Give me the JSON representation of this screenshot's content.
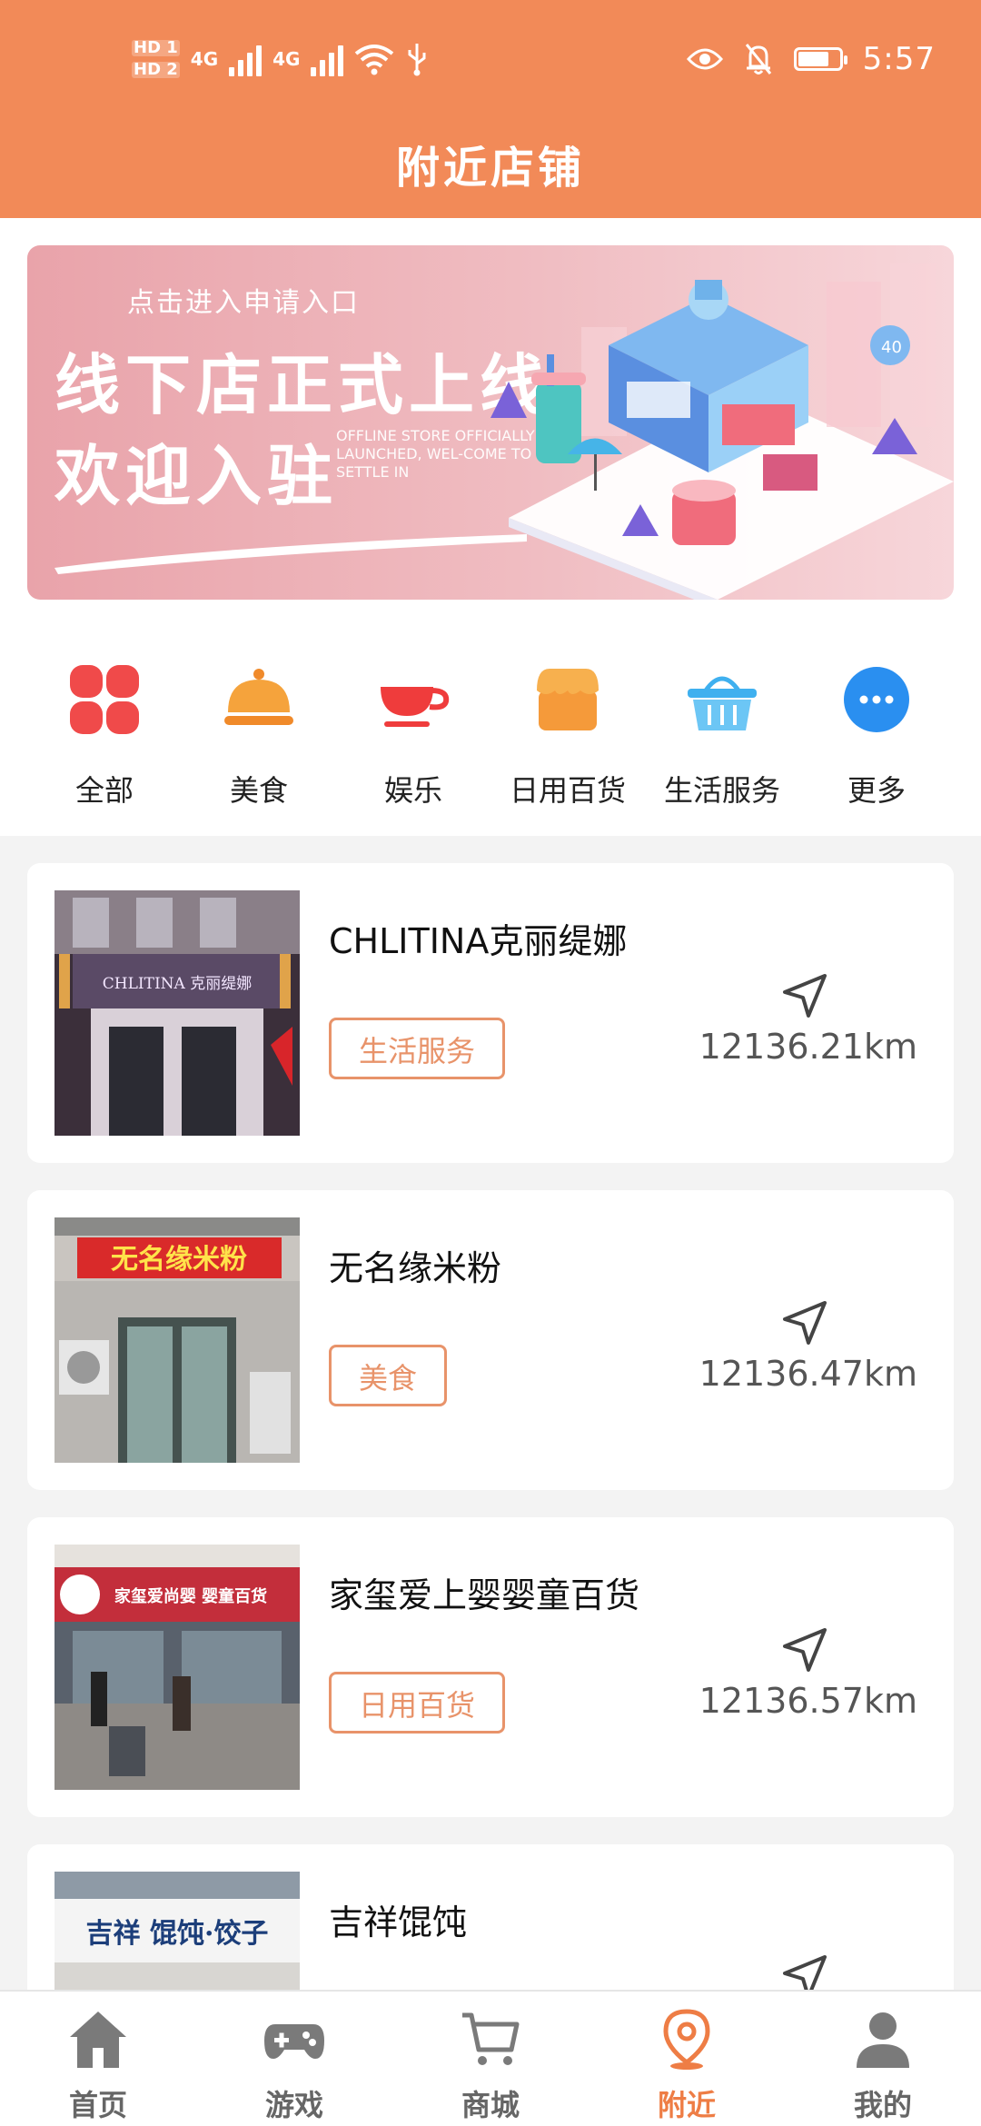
{
  "status_bar": {
    "hd1": "HD 1",
    "hd2": "HD 2",
    "net1": "4G",
    "net2": "4G",
    "time": "5:57"
  },
  "header": {
    "title": "附近店铺"
  },
  "banner": {
    "apply_text": "点击进入申请入口",
    "line1": "线下店正式上线",
    "line2": "欢迎入驻",
    "english": "OFFLINE STORE OFFICIALLY LAUNCHED, WEL-COME TO SETTLE IN"
  },
  "categories": [
    {
      "label": "全部",
      "icon": "clover-icon",
      "color": "#f04a4a"
    },
    {
      "label": "美食",
      "icon": "food-cloche-icon",
      "color": "#f08a2a"
    },
    {
      "label": "娱乐",
      "icon": "cup-icon",
      "color": "#ef3c3c"
    },
    {
      "label": "日用百货",
      "icon": "shop-icon",
      "color": "#f59a3a"
    },
    {
      "label": "生活服务",
      "icon": "basket-icon",
      "color": "#3fb0ef"
    },
    {
      "label": "更多",
      "icon": "more-icon",
      "color": "#2a8ff0"
    }
  ],
  "stores": [
    {
      "name": "CHLITINA克丽缇娜",
      "tag": "生活服务",
      "distance": "12136.21km",
      "sign": "CHLITINA 克丽缇娜"
    },
    {
      "name": "无名缘米粉",
      "tag": "美食",
      "distance": "12136.47km",
      "sign": "无名缘米粉"
    },
    {
      "name": "家玺爱上婴婴童百货",
      "tag": "日用百货",
      "distance": "12136.57km",
      "sign": "家玺爱尚婴 婴童百货"
    },
    {
      "name": "吉祥馄饨",
      "tag": "",
      "distance": "",
      "sign": "吉祥 馄饨·饺子"
    }
  ],
  "bottom_nav": [
    {
      "label": "首页",
      "icon": "home-icon"
    },
    {
      "label": "游戏",
      "icon": "gamepad-icon"
    },
    {
      "label": "商城",
      "icon": "cart-icon"
    },
    {
      "label": "附近",
      "icon": "location-pin-icon",
      "active": true
    },
    {
      "label": "我的",
      "icon": "user-icon"
    }
  ],
  "colors": {
    "header": "#f28a58",
    "accent": "#ee7d45",
    "tag_border": "#e8936a"
  }
}
